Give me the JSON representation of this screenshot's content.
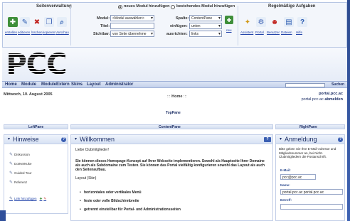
{
  "control_panel": {
    "seitenverwaltung": {
      "title": "Seitenverwaltung",
      "actions": [
        "erstellen",
        "editieren",
        "löschen",
        "kopieren",
        "Vorschau"
      ]
    },
    "modul": {
      "radio_new": "neues Modul hinzufügen",
      "radio_existing": "bestehendes Modul hinzufügen",
      "modul_label": "Modul:",
      "modul_value": "<Modul auswählen>",
      "titel_label": "Titel:",
      "titel_value": "",
      "sichtbar_label": "Sichtbar:",
      "sichtbar_value": "von Seite übernehme",
      "spalte_label": "Spalte:",
      "spalte_value": "ContentPane",
      "einfuegen_label": "einfügen:",
      "einfuegen_value": "unten",
      "ausrichten_label": "ausrichten:",
      "ausrichten_value": "links",
      "neu_label": "neu"
    },
    "regelmaessig": {
      "title": "Regelmäßige Aufgaben",
      "actions": [
        "Assistent",
        "Portal",
        "Benutzer",
        "Dateien",
        "Hilfe"
      ]
    }
  },
  "logo": "PCC",
  "nav": {
    "items": [
      "Home",
      "Module",
      "ModuleExtern",
      "Skins",
      "Layout",
      "Administrator"
    ],
    "search_label": "Suchen"
  },
  "info": {
    "date": "Mittwoch, 10. August 2005",
    "breadcrumb_prefix": ":::",
    "breadcrumb_home": "Home",
    "breadcrumb_suffix": ":::",
    "user_line1": "portal.pcc.ac",
    "user_line2": "portal.pcc.ac",
    "logout": "abmelden"
  },
  "panes": {
    "top": "TopPane",
    "left": "LeftPane",
    "content": "ContentPane",
    "right": "RightPane"
  },
  "left_module": {
    "title": "Hinweise",
    "items": [
      "Diskussion",
      "DotNetNuke",
      "Guided Tour",
      "Referenz"
    ],
    "add_link": "Link hinzufügen"
  },
  "content_module": {
    "title": "Willkommen",
    "greeting": "Liebe Clubmitglieder!",
    "para1": "Sie können dieses Homepage-Konzept auf Ihrer Webseite implementieren. Sowohl als Hauptseite Ihrer Domaine als auch als Subdomaine zum Testen. Sie können das Portal vielfältig konfigurieren sowohl das Layout als auch den Seitenaufbau.",
    "layout_heading": "Layout (Skin)",
    "bullets": [
      "horizontales oder vertikales Menü",
      "feste oder volle Bildschirmbreite",
      "getrennt einstellbar für Portal- und Administrationsseiten"
    ]
  },
  "right_module": {
    "title": "Anmeldung",
    "intro": "Bitte geben Sie Ihre E-Mail-Adresse und Mitgliedsnummer an, bei Nicht-Clubmitgliedern die Postanschrift.",
    "email_label": "E-Mail:",
    "email_value": "pcc@pcc.ac",
    "name_label": "Name:",
    "name_value": "portal.pcc.ac portal.pcc.ac",
    "betreff_label": "Betreff:"
  }
}
